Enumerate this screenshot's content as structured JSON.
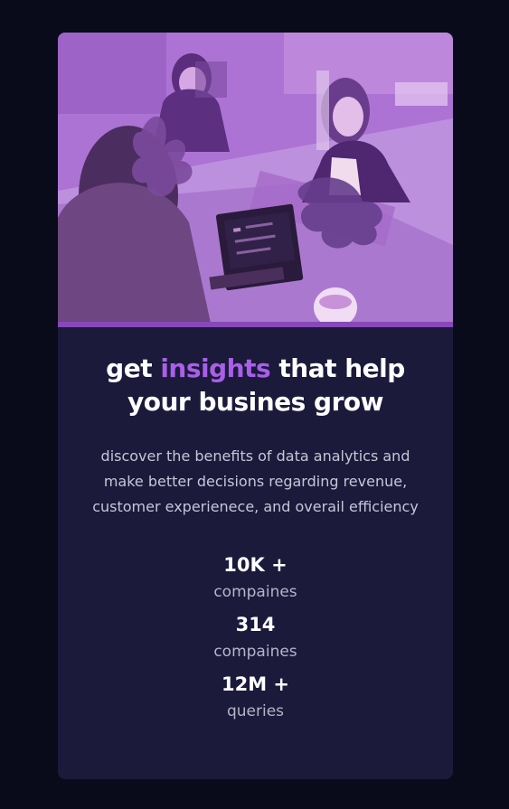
{
  "card": {
    "title_prefix": "get ",
    "title_accent": "insights",
    "title_suffix": " that help your busines grow",
    "description": "discover the benefits of data analytics and make better decisions regarding revenue, customer experienece, and overail efficiency"
  },
  "stats": [
    {
      "value": "10K +",
      "label": "compaines"
    },
    {
      "value": "314",
      "label": "compaines"
    },
    {
      "value": "12M +",
      "label": "queries"
    }
  ],
  "colors": {
    "page_background": "#090b1a",
    "card_background": "#1b1a3b",
    "accent": "#a95fe8",
    "image_tint": "#a96fd3"
  },
  "hero_image": {
    "description_icon": "office-team-photo-icon"
  }
}
